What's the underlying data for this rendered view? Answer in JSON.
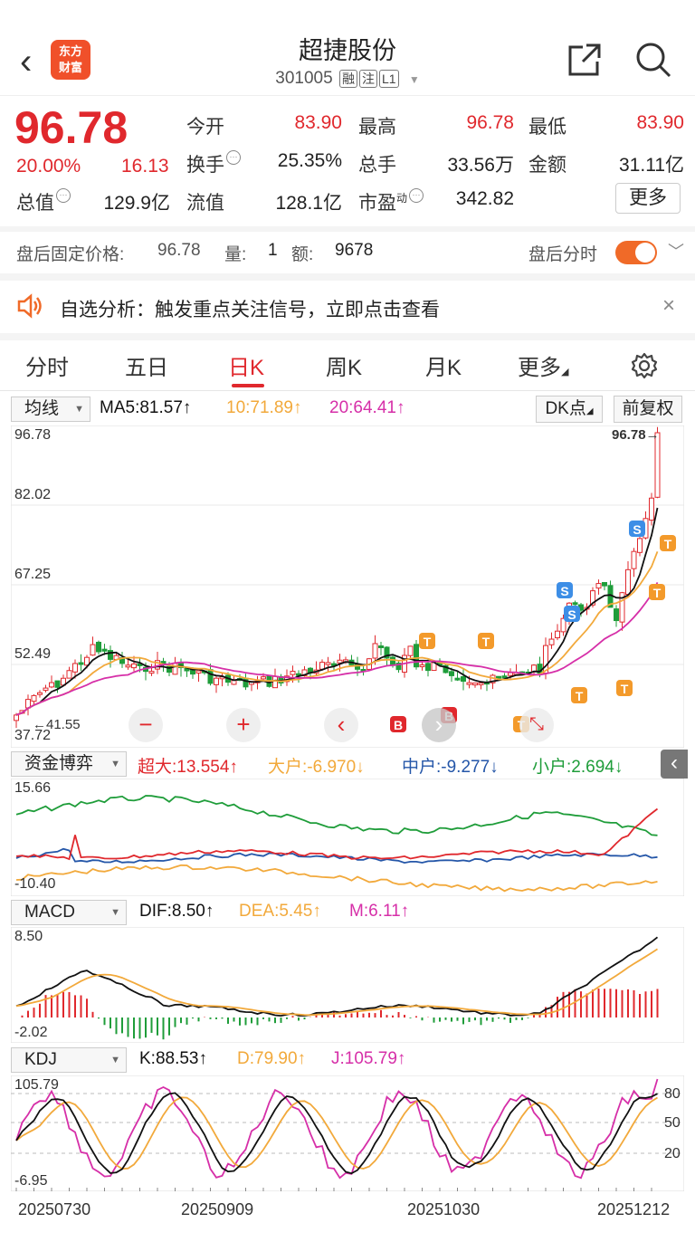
{
  "header": {
    "title": "超捷股份",
    "code": "301005",
    "tags": [
      "融",
      "注",
      "L1"
    ],
    "logo_text": [
      "东方",
      "财富"
    ]
  },
  "quote": {
    "price": "96.78",
    "change_pct": "20.00%",
    "change": "16.13",
    "labels": {
      "open": "今开",
      "high": "最高",
      "low": "最低",
      "turnover": "换手",
      "volume": "总手",
      "amount": "金额",
      "mkt_cap": "总值",
      "float_cap": "流值",
      "pe": "市盈"
    },
    "pe_suffix": "动",
    "values": {
      "open": "83.90",
      "high": "96.78",
      "low": "83.90",
      "turnover": "25.35%",
      "volume": "33.56万",
      "amount": "31.11亿",
      "mkt_cap": "129.9亿",
      "float_cap": "128.1亿",
      "pe": "342.82"
    },
    "more_label": "更多"
  },
  "after_hours": {
    "price_label": "盘后固定价格:",
    "price": "96.78",
    "qty_label": "量:",
    "qty": "1",
    "amt_label": "额:",
    "amt": "9678",
    "timeshare_label": "盘后分时"
  },
  "notice": {
    "text": "自选分析：触发重点关注信号，立即点击查看"
  },
  "tabs": [
    {
      "label": "分时"
    },
    {
      "label": "五日"
    },
    {
      "label": "日K",
      "active": true
    },
    {
      "label": "周K"
    },
    {
      "label": "月K"
    },
    {
      "label": "更多"
    }
  ],
  "kline": {
    "selector": "均线",
    "ma5": "MA5:81.57↑",
    "ma10": "10:71.89↑",
    "ma20": "20:64.41↑",
    "dk_btn": "DK点",
    "fq_btn": "前复权",
    "y_labels": [
      "96.78",
      "82.02",
      "67.25",
      "52.49",
      "37.72"
    ],
    "high_marker": "96.78",
    "low_marker": "41.55"
  },
  "capital": {
    "selector": "资金博弈",
    "super": "超大:13.554↑",
    "large": "大户:-6.970↓",
    "mid": "中户:-9.277↓",
    "small": "小户:2.694↓",
    "y_top": "15.66",
    "y_bottom": "-10.40"
  },
  "macd": {
    "selector": "MACD",
    "dif": "DIF:8.50↑",
    "dea": "DEA:5.45↑",
    "m": "M:6.11↑",
    "y_top": "8.50",
    "y_bottom": "-2.02"
  },
  "kdj": {
    "selector": "KDJ",
    "k": "K:88.53↑",
    "d": "D:79.90↑",
    "j": "J:105.79↑",
    "y_top": "105.79",
    "y_bottom": "-6.95",
    "levels": [
      "80",
      "50",
      "20"
    ]
  },
  "dates": [
    "20250730",
    "20250909",
    "20251030",
    "20251212"
  ],
  "colors": {
    "up": "#e0282d",
    "down": "#1f9d3a",
    "ma5": "#111111",
    "ma10": "#f2a93b",
    "ma20": "#d62fa8",
    "mid": "#2456a8",
    "accent": "#f06a28"
  }
}
